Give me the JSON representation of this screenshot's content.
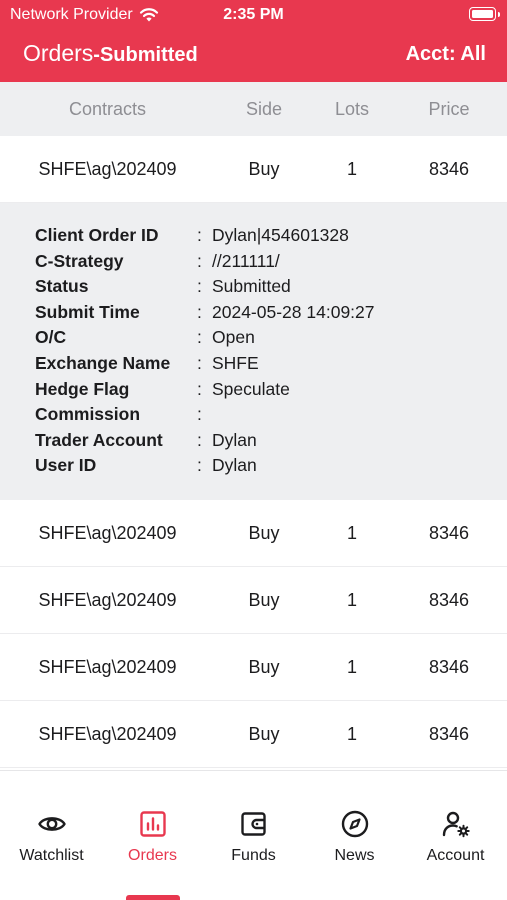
{
  "status_bar": {
    "carrier": "Network Provider",
    "time": "2:35 PM"
  },
  "header": {
    "title": "Orders",
    "subtitle": "-Submitted",
    "account": "Acct: All"
  },
  "columns": {
    "contract": "Contracts",
    "side": "Side",
    "lots": "Lots",
    "price": "Price"
  },
  "orders": [
    {
      "contract": "SHFE\\ag\\202409",
      "side": "Buy",
      "lots": "1",
      "price": "8346"
    },
    {
      "contract": "SHFE\\ag\\202409",
      "side": "Buy",
      "lots": "1",
      "price": "8346"
    },
    {
      "contract": "SHFE\\ag\\202409",
      "side": "Buy",
      "lots": "1",
      "price": "8346"
    },
    {
      "contract": "SHFE\\ag\\202409",
      "side": "Buy",
      "lots": "1",
      "price": "8346"
    },
    {
      "contract": "SHFE\\ag\\202409",
      "side": "Buy",
      "lots": "1",
      "price": "8346"
    }
  ],
  "details": [
    {
      "key": "Client Order ID",
      "value": "Dylan|454601328"
    },
    {
      "key": "C-Strategy",
      "value": "//211111/"
    },
    {
      "key": "Status",
      "value": "Submitted"
    },
    {
      "key": "Submit Time",
      "value": "2024-05-28 14:09:27"
    },
    {
      "key": "O/C",
      "value": "Open"
    },
    {
      "key": "Exchange Name",
      "value": "SHFE"
    },
    {
      "key": "Hedge Flag",
      "value": "Speculate"
    },
    {
      "key": "Commission",
      "value": ""
    },
    {
      "key": "Trader Account",
      "value": "Dylan"
    },
    {
      "key": "User ID",
      "value": "Dylan"
    }
  ],
  "detail_colon": ":",
  "tabs": [
    {
      "label": "Watchlist",
      "icon": "eye-icon"
    },
    {
      "label": "Orders",
      "icon": "orders-chart-icon"
    },
    {
      "label": "Funds",
      "icon": "wallet-icon"
    },
    {
      "label": "News",
      "icon": "compass-icon"
    },
    {
      "label": "Account",
      "icon": "account-settings-icon"
    }
  ],
  "active_tab": "Orders",
  "colors": {
    "brand": "#e8384f",
    "header_bg": "#eeeff1",
    "text": "#1c1c1e",
    "muted": "#8e8e93"
  }
}
